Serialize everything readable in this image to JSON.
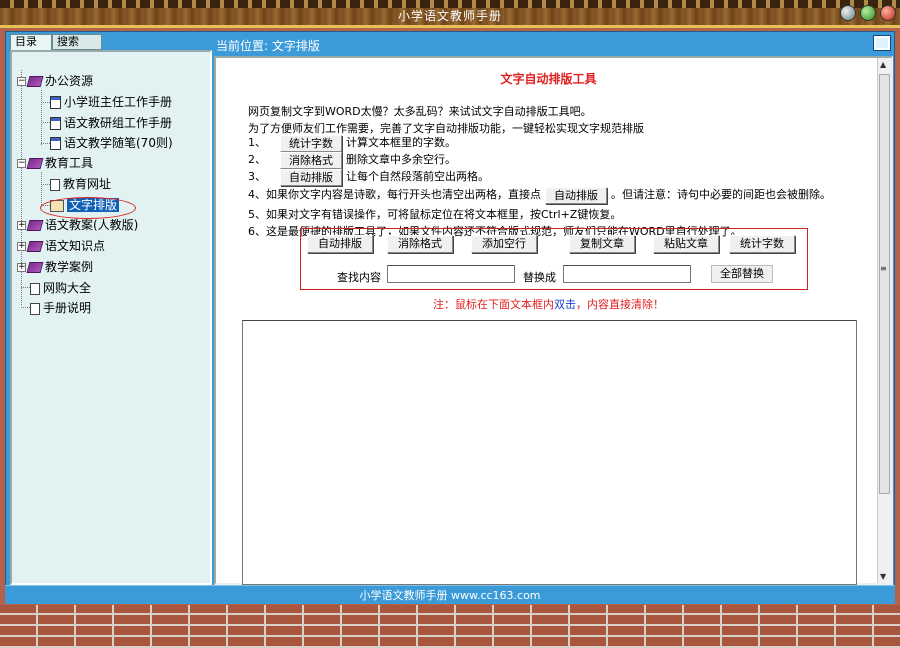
{
  "window": {
    "title": "小学语文教师手册"
  },
  "sidebar": {
    "tabs": [
      "目录",
      "搜索"
    ],
    "tree": [
      {
        "label": "办公资源"
      },
      {
        "label": "小学班主任工作手册"
      },
      {
        "label": "语文教研组工作手册"
      },
      {
        "label": "语文教学随笔(70则)"
      },
      {
        "label": "教育工具"
      },
      {
        "label": "教育网址"
      },
      {
        "label": "文字排版"
      },
      {
        "label": "语文教案(人教版)"
      },
      {
        "label": "语文知识点"
      },
      {
        "label": "教学案例"
      },
      {
        "label": "网购大全"
      },
      {
        "label": "手册说明"
      }
    ]
  },
  "breadcrumb": "当前位置: 文字排版",
  "tool": {
    "title": "文字自动排版工具",
    "intro1": "网页复制文字到WORD太慢？太多乱码？来试试文字自动排版工具吧。",
    "intro2": "为了方便师友们工作需要，完善了文字自动排版功能，一键轻松实现文字规范排版",
    "step1_num": "1、",
    "step1_btn": "统计字数",
    "step1_text": "计算文本框里的字数。",
    "step2_num": "2、",
    "step2_btn": "消除格式",
    "step2_text": "删除文章中多余空行。",
    "step3_num": "3、",
    "step3_btn": "自动排版",
    "step3_text": "让每个自然段落前空出两格。",
    "step4_pre": "4、如果你文字内容是诗歌，每行开头也清空出两格，直接点",
    "step4_btn": "自动排版",
    "step4_post": "。但请注意：诗句中必要的间距也会被删除。",
    "step5": "5、如果对文字有错误操作，可将鼠标定位在将文本框里，按Ctrl+Z键恢复。",
    "step6": "6、这是最便捷的排版工具了，如果文件内容还不符合版式规范，师友们只能在WORD里自行处理了。",
    "buttons": [
      "自动排版",
      "消除格式",
      "添加空行",
      "复制文章",
      "粘贴文章",
      "统计字数"
    ],
    "find_label": "查找内容",
    "replace_label": "替换成",
    "replace_all": "全部替换",
    "note_pre": "注：鼠标在下面文本框内",
    "note_hl": "双击",
    "note_post": "，内容直接清除！"
  },
  "status": "小学语文教师手册 www.cc163.com"
}
